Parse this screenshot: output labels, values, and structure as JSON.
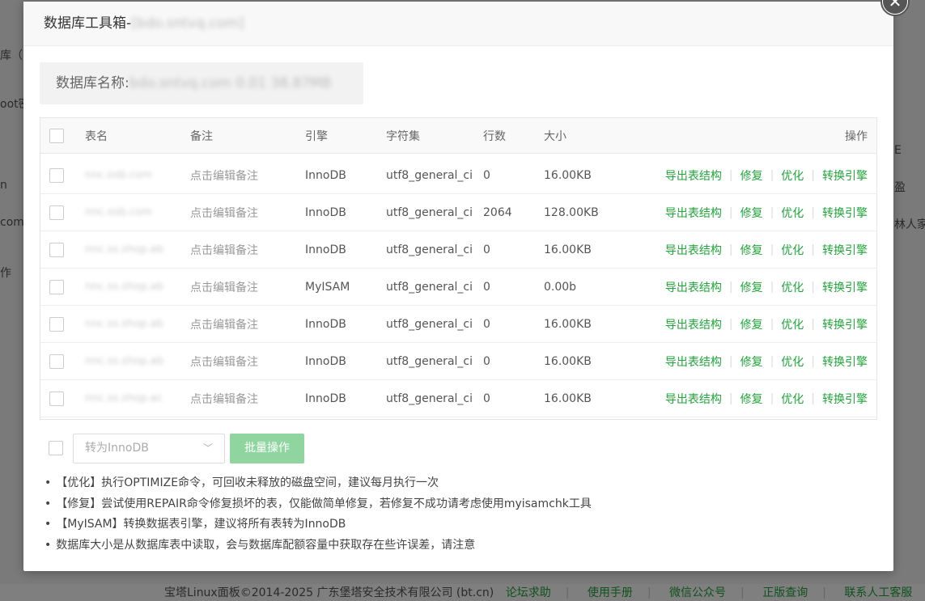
{
  "background": {
    "fragments": [
      "库（",
      "oot密",
      "n",
      "com",
      "作",
      "E",
      "盈",
      "林人家"
    ],
    "footer": {
      "copyright": "宝塔Linux面板©2014-2025 广东堡塔安全技术有限公司 (bt.cn)",
      "links": [
        "论坛求助",
        "使用手册",
        "微信公众号",
        "正版查询",
        "联系人工客服"
      ]
    }
  },
  "dialog": {
    "title_prefix": "数据库工具箱-",
    "title_name": "[bdo.sntvq.com]",
    "close_icon": "close-icon",
    "db_label": "数据库名称:",
    "db_value": "bdo.sntvq.com 0.01 38.87MB",
    "table": {
      "headers": {
        "name": "表名",
        "note": "备注",
        "engine": "引擎",
        "charset": "字符集",
        "rows": "行数",
        "size": "大小",
        "ops": "操作"
      },
      "rows": [
        {
          "name": "nnc.osb.com",
          "note": "点击编辑备注",
          "engine": "InnoDB",
          "charset": "utf8_general_ci",
          "rows": "0",
          "size": "16.00KB"
        },
        {
          "name": "nnc.osb.com",
          "note": "点击编辑备注",
          "engine": "InnoDB",
          "charset": "utf8_general_ci",
          "rows": "2064",
          "size": "128.00KB"
        },
        {
          "name": "nnc.ss.shop.ab",
          "note": "点击编辑备注",
          "engine": "InnoDB",
          "charset": "utf8_general_ci",
          "rows": "0",
          "size": "16.00KB"
        },
        {
          "name": "nnc.ss.shop.ab",
          "note": "点击编辑备注",
          "engine": "MyISAM",
          "charset": "utf8_general_ci",
          "rows": "0",
          "size": "0.00b"
        },
        {
          "name": "nnc.ss.shop.ab",
          "note": "点击编辑备注",
          "engine": "InnoDB",
          "charset": "utf8_general_ci",
          "rows": "0",
          "size": "16.00KB"
        },
        {
          "name": "nnc.ss.shop.ab",
          "note": "点击编辑备注",
          "engine": "InnoDB",
          "charset": "utf8_general_ci",
          "rows": "0",
          "size": "16.00KB"
        },
        {
          "name": "nnc.ss.shop.ac",
          "note": "点击编辑备注",
          "engine": "InnoDB",
          "charset": "utf8_general_ci",
          "rows": "0",
          "size": "16.00KB"
        }
      ],
      "ops": [
        "导出表结构",
        "修复",
        "优化",
        "转换引擎"
      ]
    },
    "bottom": {
      "select_value": "转为InnoDB",
      "batch_label": "批量操作"
    },
    "notes": [
      "【优化】执行OPTIMIZE命令，可回收未释放的磁盘空间，建议每月执行一次",
      "【修复】尝试使用REPAIR命令修复损坏的表，仅能做简单修复，若修复不成功请考虑使用myisamchk工具",
      "【MyISAM】转换数据表引擎，建议将所有表转为InnoDB",
      "数据库大小是从数据库表中读取，会与数据库配额容量中获取存在些许误差，请注意"
    ]
  }
}
